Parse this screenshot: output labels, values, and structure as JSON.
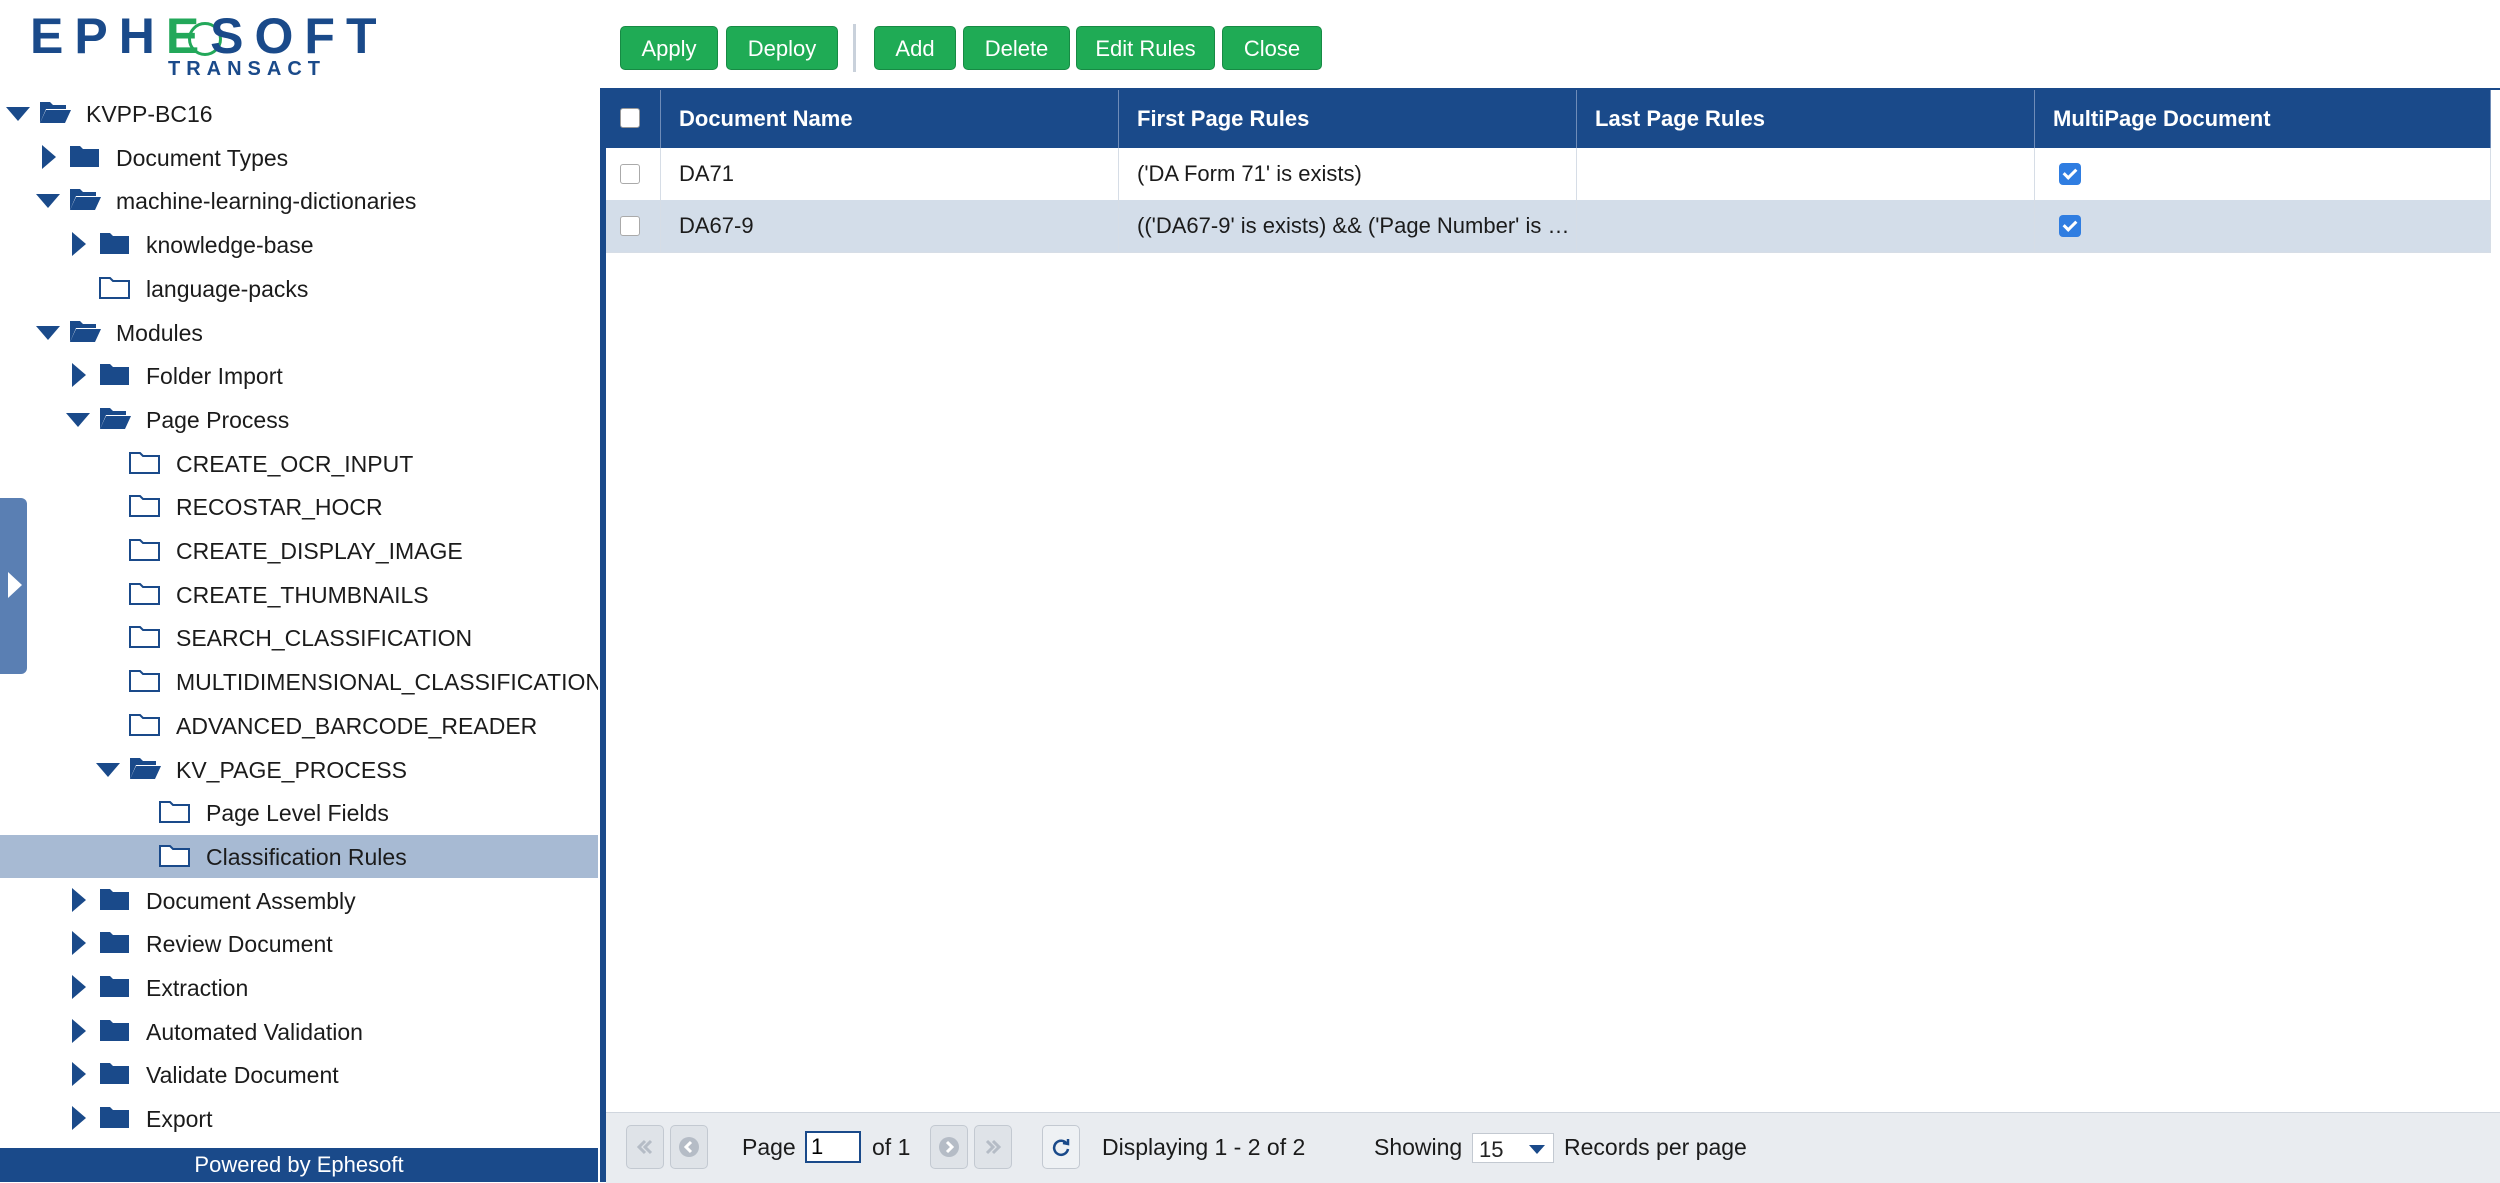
{
  "logo": {
    "brand": "EPHESOFT",
    "product": "TRANSACT"
  },
  "tree": [
    {
      "label": "KVPP-BC16",
      "level": 0,
      "expanded": true,
      "open_folder": true,
      "has_arrow": true,
      "icon": "folder-open-icon"
    },
    {
      "label": "Document Types",
      "level": 1,
      "expanded": false,
      "open_folder": false,
      "has_arrow": true,
      "icon": "folder-icon"
    },
    {
      "label": "machine-learning-dictionaries",
      "level": 1,
      "expanded": true,
      "open_folder": true,
      "has_arrow": true,
      "icon": "folder-open-icon"
    },
    {
      "label": "knowledge-base",
      "level": 2,
      "expanded": false,
      "open_folder": false,
      "has_arrow": true,
      "icon": "folder-icon"
    },
    {
      "label": "language-packs",
      "level": 2,
      "leaf": true,
      "icon": "folder-outline-icon"
    },
    {
      "label": "Modules",
      "level": 1,
      "expanded": true,
      "open_folder": true,
      "has_arrow": true,
      "icon": "folder-open-icon"
    },
    {
      "label": "Folder Import",
      "level": 2,
      "expanded": false,
      "has_arrow": true,
      "icon": "folder-icon"
    },
    {
      "label": "Page Process",
      "level": 2,
      "expanded": true,
      "open_folder": true,
      "has_arrow": true,
      "icon": "folder-open-icon"
    },
    {
      "label": "CREATE_OCR_INPUT",
      "level": 3,
      "leaf": true,
      "icon": "folder-outline-icon"
    },
    {
      "label": "RECOSTAR_HOCR",
      "level": 3,
      "leaf": true,
      "icon": "folder-outline-icon"
    },
    {
      "label": "CREATE_DISPLAY_IMAGE",
      "level": 3,
      "leaf": true,
      "icon": "folder-outline-icon"
    },
    {
      "label": "CREATE_THUMBNAILS",
      "level": 3,
      "leaf": true,
      "icon": "folder-outline-icon"
    },
    {
      "label": "SEARCH_CLASSIFICATION",
      "level": 3,
      "leaf": true,
      "icon": "folder-outline-icon"
    },
    {
      "label": "MULTIDIMENSIONAL_CLASSIFICATION_P",
      "level": 3,
      "leaf": true,
      "icon": "folder-outline-icon"
    },
    {
      "label": "ADVANCED_BARCODE_READER",
      "level": 3,
      "leaf": true,
      "icon": "folder-outline-icon"
    },
    {
      "label": "KV_PAGE_PROCESS",
      "level": 3,
      "expanded": true,
      "open_folder": true,
      "has_arrow": true,
      "icon": "folder-open-icon"
    },
    {
      "label": "Page Level Fields",
      "level": 4,
      "leaf": true,
      "icon": "folder-outline-icon"
    },
    {
      "label": "Classification Rules",
      "level": 4,
      "leaf": true,
      "selected": true,
      "icon": "folder-outline-icon"
    },
    {
      "label": "Document Assembly",
      "level": 2,
      "expanded": false,
      "has_arrow": true,
      "icon": "folder-icon"
    },
    {
      "label": "Review Document",
      "level": 2,
      "expanded": false,
      "has_arrow": true,
      "icon": "folder-icon"
    },
    {
      "label": "Extraction",
      "level": 2,
      "expanded": false,
      "has_arrow": true,
      "icon": "folder-icon"
    },
    {
      "label": "Automated Validation",
      "level": 2,
      "expanded": false,
      "has_arrow": true,
      "icon": "folder-icon"
    },
    {
      "label": "Validate Document",
      "level": 2,
      "expanded": false,
      "has_arrow": true,
      "icon": "folder-icon"
    },
    {
      "label": "Export",
      "level": 2,
      "expanded": false,
      "has_arrow": true,
      "icon": "folder-icon"
    }
  ],
  "footer": {
    "powered_by": "Powered by Ephesoft"
  },
  "toolbar": {
    "buttons": [
      "Apply",
      "Deploy",
      "Add",
      "Delete",
      "Edit Rules",
      "Close"
    ]
  },
  "grid": {
    "columns": [
      "Document Name",
      "First Page Rules",
      "Last Page Rules",
      "MultiPage Document"
    ],
    "rows": [
      {
        "document_name": "DA71",
        "first_page_rules": "('DA Form 71' is exists)",
        "last_page_rules": "",
        "multipage": true
      },
      {
        "document_name": "DA67-9",
        "first_page_rules": "(('DA67-9' is exists) && ('Page Number' is e...",
        "last_page_rules": "",
        "multipage": true
      }
    ]
  },
  "paging": {
    "page_label": "Page",
    "page_value": "1",
    "of_label": "of 1",
    "displaying": "Displaying 1 - 2 of 2",
    "showing_label": "Showing",
    "per_page_value": "15",
    "records_label": "Records per page"
  },
  "colors": {
    "primary": "#1a4a8a",
    "button_green": "#1fab55",
    "selected_row": "#a7bad3",
    "alt_row": "#d3dde9",
    "checkbox_blue": "#2f7de1"
  }
}
